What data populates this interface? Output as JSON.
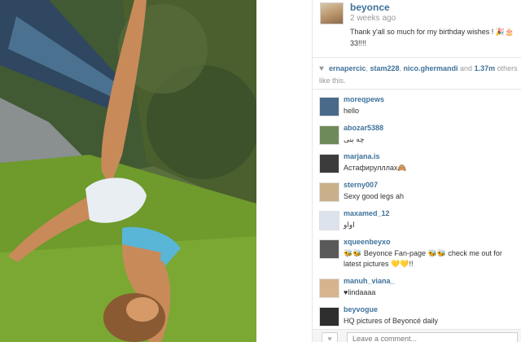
{
  "post": {
    "username": "beyonce",
    "time": "2 weeks ago",
    "caption": "Thank y'all so much for my birthday wishes ! 🎉🎂33!!!!",
    "avatar_icon": "profile-photo-icon"
  },
  "likes": {
    "users": [
      "ernapercic",
      "stam228",
      "nico.ghermandi"
    ],
    "sep": ", ",
    "and_text": " and ",
    "count": "1.37m",
    "rest": " others like this."
  },
  "comments": [
    {
      "user": "moreqpews",
      "text": "hello",
      "avatar_color": "#4a6a8a"
    },
    {
      "user": "abozar5388",
      "text": "چه بنی",
      "avatar_color": "#6e8a5a"
    },
    {
      "user": "marjana.is",
      "text": "Астафирулл️лах🙈",
      "avatar_color": "#3b3b3b"
    },
    {
      "user": "sterny007",
      "text": "Sexy good legs ah",
      "avatar_color": "#c9b08a"
    },
    {
      "user": "maxamed_12",
      "text": "اواو",
      "avatar_color": "#dde3ec"
    },
    {
      "user": "xqueenbeyxo",
      "text": "🐝🐝 Beyonce Fan-page 🐝🐝 check me out for latest pictures 💛💛!!",
      "avatar_color": "#5a5a5a"
    },
    {
      "user": "manuh_viana_",
      "text": "♥lindaaaa",
      "avatar_color": "#d8b48e"
    },
    {
      "user": "beyvogue",
      "text": "HQ pictures of Beyoncé daily",
      "avatar_color": "#2e2e2e"
    }
  ],
  "comment_box": {
    "placeholder": "Leave a comment...",
    "like_icon": "heart-icon"
  },
  "colors": {
    "link": "#3f729b",
    "text": "#333333",
    "muted": "#999999"
  }
}
